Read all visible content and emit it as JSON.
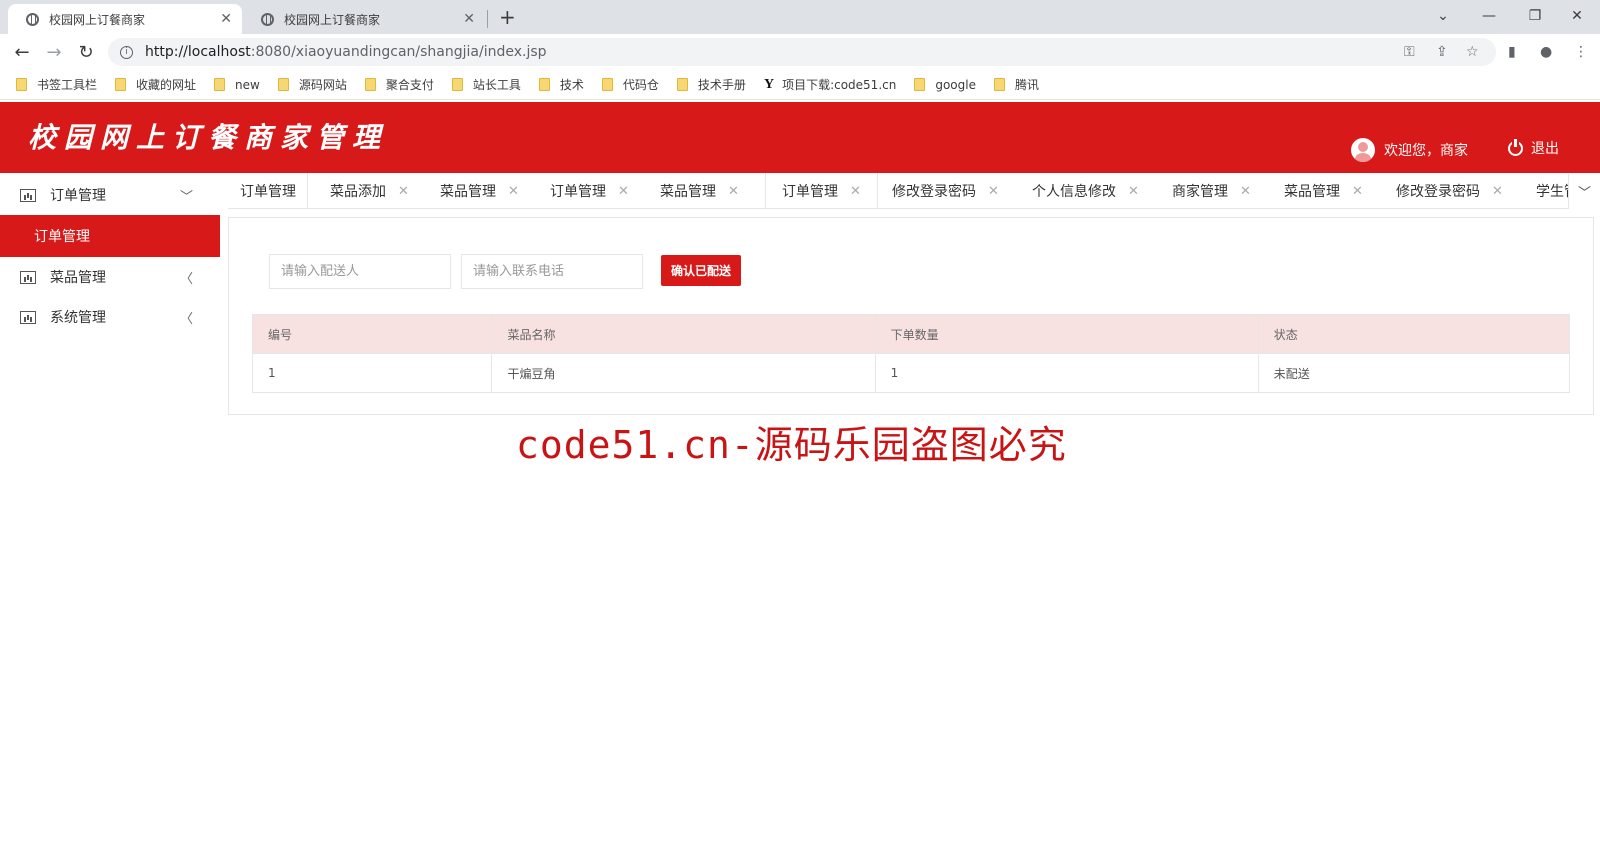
{
  "browser": {
    "tabs": [
      {
        "title": "校园网上订餐商家",
        "active": true
      },
      {
        "title": "校园网上订餐商家",
        "active": false
      }
    ],
    "new_tab": "+",
    "url_host": "http://localhost",
    "url_rest": ":8080/xiaoyuandingcan/shangjia/index.jsp",
    "bookmarks": [
      "书签工具栏",
      "收藏的网址",
      "new",
      "源码网站",
      "聚合支付",
      "站长工具",
      "技术",
      "代码仓",
      "技术手册",
      "项目下载:code51.cn",
      "google",
      "腾讯"
    ]
  },
  "header": {
    "title": "校园网上订餐商家管理",
    "welcome": "欢迎您，商家",
    "logout": "退出",
    "color": "#d71919"
  },
  "sidebar": {
    "groups": [
      {
        "label": "订单管理",
        "expanded": true,
        "children": [
          "订单管理"
        ]
      },
      {
        "label": "菜品管理",
        "expanded": false
      },
      {
        "label": "系统管理",
        "expanded": false
      }
    ]
  },
  "content_tabs": [
    "订单管理",
    "菜品添加",
    "菜品管理",
    "订单管理",
    "菜品管理",
    "订单管理",
    "修改登录密码",
    "个人信息修改",
    "商家管理",
    "菜品管理",
    "修改登录密码",
    "学生管"
  ],
  "search": {
    "deliverer_placeholder": "请输入配送人",
    "phone_placeholder": "请输入联系电话",
    "confirm_label": "确认已配送"
  },
  "table": {
    "headers": [
      "编号",
      "菜品名称",
      "下单数量",
      "状态"
    ],
    "rows": [
      [
        "1",
        "干煸豆角",
        "1",
        "未配送"
      ]
    ]
  },
  "watermark": "code51.cn-源码乐园盗图必究"
}
